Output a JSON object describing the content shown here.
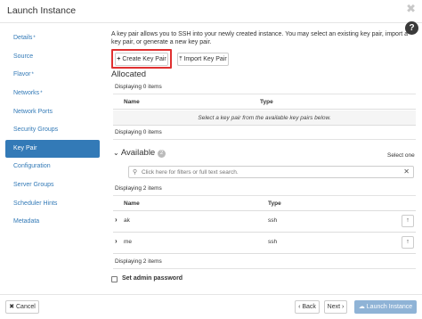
{
  "window": {
    "title": "Launch Instance",
    "close_glyph": "✖",
    "help_glyph": "?"
  },
  "sidebar": {
    "items": [
      {
        "label": "Details",
        "required": true
      },
      {
        "label": "Source",
        "required": false
      },
      {
        "label": "Flavor",
        "required": true
      },
      {
        "label": "Networks",
        "required": true
      },
      {
        "label": "Network Ports",
        "required": false
      },
      {
        "label": "Security Groups",
        "required": false
      },
      {
        "label": "Key Pair",
        "required": false,
        "active": true
      },
      {
        "label": "Configuration",
        "required": false
      },
      {
        "label": "Server Groups",
        "required": false
      },
      {
        "label": "Scheduler Hints",
        "required": false
      },
      {
        "label": "Metadata",
        "required": false
      }
    ],
    "required_mark": "*"
  },
  "main": {
    "description": "A key pair allows you to SSH into your newly created instance. You may select an existing key pair, import a key pair, or generate a new key pair.",
    "create_button": {
      "icon": "+",
      "label": "Create Key Pair"
    },
    "import_button": {
      "icon": "⤒",
      "label": "Import Key Pair"
    },
    "allocated": {
      "title": "Allocated",
      "displaying_top": "Displaying 0 items",
      "col_name": "Name",
      "col_type": "Type",
      "empty_message": "Select a key pair from the available key pairs below.",
      "displaying_bottom": "Displaying 0 items"
    },
    "available": {
      "title": "Available",
      "count": "2",
      "select_hint": "Select one",
      "filter_placeholder": "Click here for filters or full text search.",
      "displaying_top": "Displaying 2 items",
      "col_name": "Name",
      "col_type": "Type",
      "rows": [
        {
          "name": "ak",
          "type": "ssh"
        },
        {
          "name": "me",
          "type": "ssh"
        }
      ],
      "displaying_bottom": "Displaying 2 items"
    },
    "admin_password_label": "Set admin password"
  },
  "footer": {
    "cancel": "✖ Cancel",
    "back": "‹ Back",
    "next": "Next ›",
    "launch": "Launch Instance",
    "launch_icon": "☁"
  }
}
